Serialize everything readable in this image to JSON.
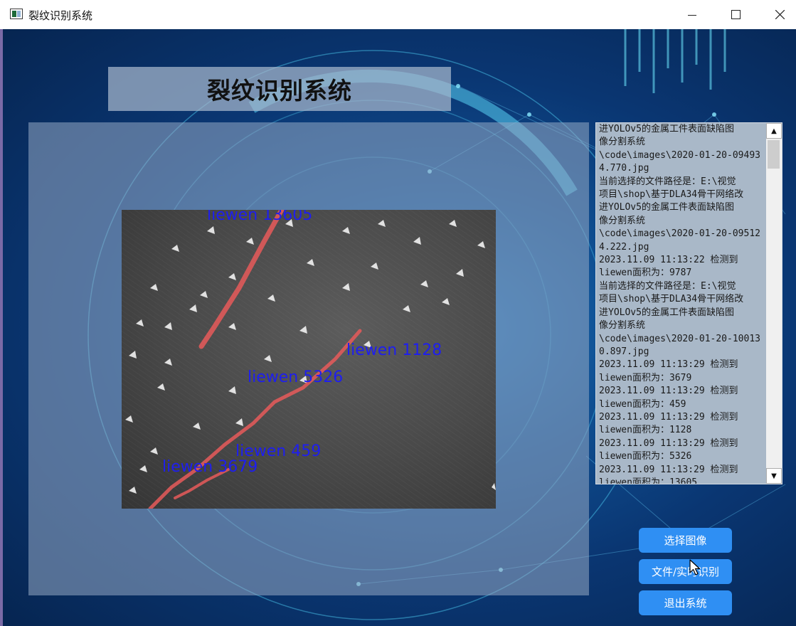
{
  "window": {
    "title": "裂纹识别系统"
  },
  "header": {
    "title": "裂纹识别系统"
  },
  "result_image": {
    "labels": [
      {
        "text": "liewen 13605"
      },
      {
        "text": "liewen 1128"
      },
      {
        "text": "liewen 5326"
      },
      {
        "text": "liewen 459"
      },
      {
        "text": "liewen 3679"
      }
    ],
    "label_color": "#1e1ef0",
    "mask_color": "#e85a5a"
  },
  "log": {
    "text": "进YOLOv5的金属工件表面缺陷图\n像分割系统\n\\code\\images\\2020-01-20-09493\n4.770.jpg\n当前选择的文件路径是：E:\\视觉\n项目\\shop\\基于DLA34骨干网络改\n进YOLOv5的金属工件表面缺陷图\n像分割系统\n\\code\\images\\2020-01-20-09512\n4.222.jpg\n2023.11.09 11:13:22 检测到\nliewen面积为：9787\n当前选择的文件路径是：E:\\视觉\n项目\\shop\\基于DLA34骨干网络改\n进YOLOv5的金属工件表面缺陷图\n像分割系统\n\\code\\images\\2020-01-20-10013\n0.897.jpg\n2023.11.09 11:13:29 检测到\nliewen面积为：3679\n2023.11.09 11:13:29 检测到\nliewen面积为：459\n2023.11.09 11:13:29 检测到\nliewen面积为：1128\n2023.11.09 11:13:29 检测到\nliewen面积为：5326\n2023.11.09 11:13:29 检测到\nliewen面积为：13605"
  },
  "buttons": {
    "select_image": "选择图像",
    "file_realtime": "文件/实时识别",
    "exit": "退出系统"
  },
  "colors": {
    "button": "#2f8ff3",
    "background": "#0a3672"
  }
}
